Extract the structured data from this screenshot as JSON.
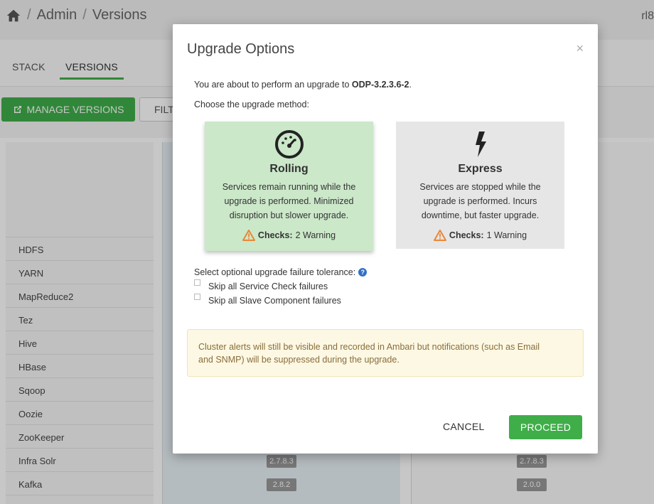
{
  "breadcrumb": {
    "items": [
      "Admin",
      "Versions"
    ],
    "separator": "/"
  },
  "header": {
    "user_label": "rl8"
  },
  "tabs": [
    {
      "label": "STACK"
    },
    {
      "label": "VERSIONS",
      "active": true
    }
  ],
  "toolbar": {
    "manage_label": "MANAGE VERSIONS",
    "filter_label": "FILT"
  },
  "services": [
    "HDFS",
    "YARN",
    "MapReduce2",
    "Tez",
    "Hive",
    "HBase",
    "Sqoop",
    "Oozie",
    "ZooKeeper",
    "Infra Solr",
    "Kafka"
  ],
  "versions_col1": [
    "2.7.8.3",
    "2.8.2"
  ],
  "versions_col2": [
    "2.7.8.3",
    "2.0.0"
  ],
  "modal": {
    "title": "Upgrade Options",
    "close": "×",
    "intro_prefix": "You are about to perform an upgrade to ",
    "target_version": "ODP-3.2.3.6-2",
    "intro_suffix": ".",
    "choose": "Choose the upgrade method:",
    "rolling": {
      "name": "Rolling",
      "desc": "Services remain running while the upgrade is performed. Minimized disruption but slower upgrade.",
      "checks_label": "Checks:",
      "checks_value": "2 Warning"
    },
    "express": {
      "name": "Express",
      "desc": "Services are stopped while the upgrade is performed. Incurs downtime, but faster upgrade.",
      "checks_label": "Checks:",
      "checks_value": "1 Warning"
    },
    "tolerance_label": "Select optional upgrade failure tolerance:",
    "skip_service_check": "Skip all Service Check failures",
    "skip_slave_component": "Skip all Slave Component failures",
    "alert": "Cluster alerts will still be visible and recorded in Ambari but notifications (such as Email and SNMP) will be suppressed during the upgrade.",
    "cancel_label": "CANCEL",
    "proceed_label": "PROCEED"
  },
  "colors": {
    "accent": "#3fae49",
    "warning": "#e8873a",
    "alert_bg": "#fcf8e3"
  }
}
